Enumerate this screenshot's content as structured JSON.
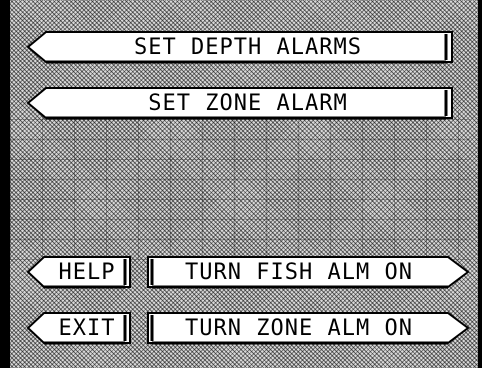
{
  "menu": {
    "set_depth_alarms": "SET DEPTH ALARMS",
    "set_zone_alarm": "SET ZONE ALARM",
    "help": "HELP",
    "turn_fish_alm_on": "TURN FISH ALM ON",
    "exit": "EXIT",
    "turn_zone_alm_on": "TURN ZONE ALM ON"
  },
  "icons": {
    "left_arrow": "left-arrow-icon",
    "right_arrow": "right-arrow-icon"
  },
  "colors": {
    "button_fill": "#ffffff",
    "border": "#000000",
    "background": "#d8d8d8"
  }
}
